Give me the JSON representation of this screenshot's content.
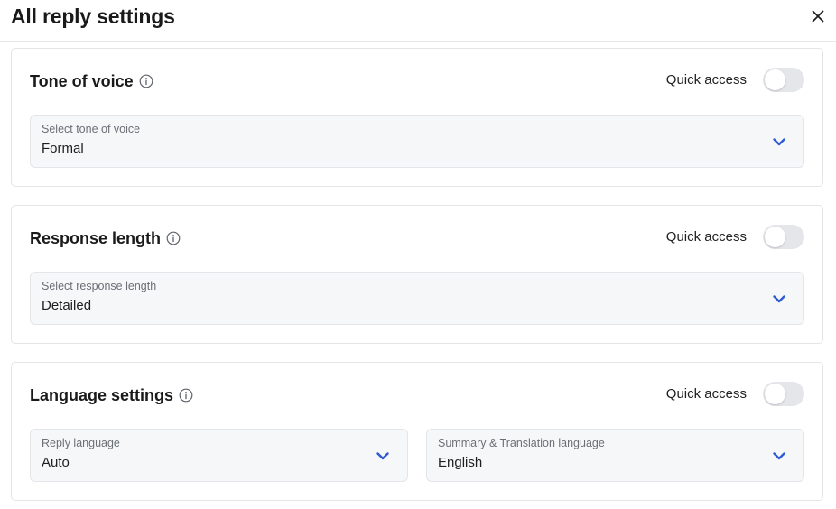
{
  "header": {
    "title": "All reply settings",
    "close_icon": "close-icon"
  },
  "colors": {
    "accent": "#2f5bd3",
    "toggle_off": "#e4e6ea",
    "select_bg": "#f6f7f9"
  },
  "sections": [
    {
      "title": "Tone of voice",
      "quick_access_label": "Quick access",
      "quick_access_on": false,
      "select": {
        "label": "Select tone of voice",
        "value": "Formal"
      }
    },
    {
      "title": "Response length",
      "quick_access_label": "Quick access",
      "quick_access_on": false,
      "select": {
        "label": "Select response length",
        "value": "Detailed"
      }
    },
    {
      "title": "Language settings",
      "quick_access_label": "Quick access",
      "quick_access_on": false,
      "selects": [
        {
          "label": "Reply language",
          "value": "Auto"
        },
        {
          "label": "Summary & Translation language",
          "value": "English"
        }
      ]
    }
  ]
}
